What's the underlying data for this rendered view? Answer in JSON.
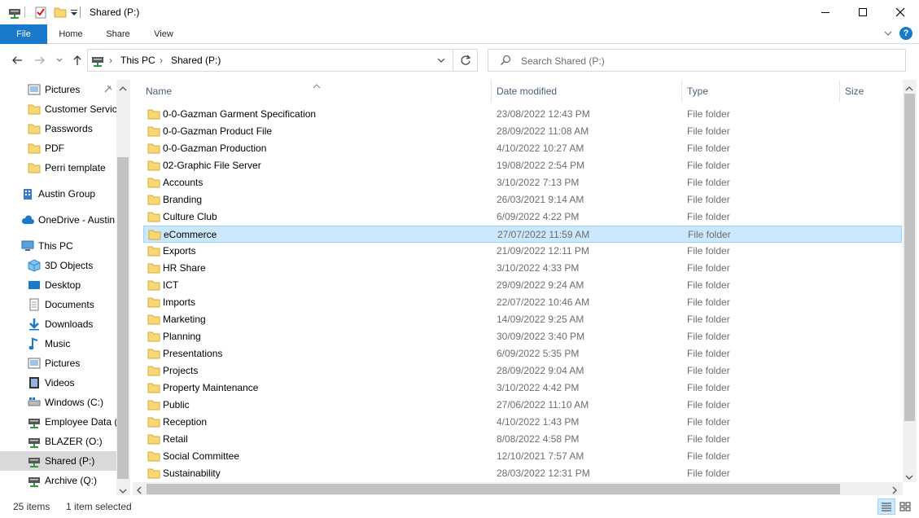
{
  "window": {
    "title": "Shared (P:)",
    "minimize_glyph": "—",
    "maximize_glyph": "☐",
    "close_glyph": "✕"
  },
  "ribbon": {
    "tabs": [
      "File",
      "Home",
      "Share",
      "View"
    ],
    "help_glyph": "?"
  },
  "address": {
    "crumbs": [
      "This PC",
      "Shared (P:)"
    ],
    "search_placeholder": "Search Shared (P:)"
  },
  "sidebar": {
    "items": [
      {
        "label": "Pictures",
        "icon": "pictures-icon",
        "pinned": true
      },
      {
        "label": "Customer Servic",
        "icon": "folder-icon"
      },
      {
        "label": "Passwords",
        "icon": "folder-icon"
      },
      {
        "label": "PDF",
        "icon": "folder-icon"
      },
      {
        "label": "Perri template",
        "icon": "folder-icon"
      },
      {
        "label": "Austin Group",
        "icon": "building-icon"
      },
      {
        "label": "OneDrive - Austin",
        "icon": "cloud-icon"
      },
      {
        "label": "This PC",
        "icon": "pc-icon"
      },
      {
        "label": "3D Objects",
        "icon": "cube-icon"
      },
      {
        "label": "Desktop",
        "icon": "desktop-icon"
      },
      {
        "label": "Documents",
        "icon": "documents-icon"
      },
      {
        "label": "Downloads",
        "icon": "download-icon"
      },
      {
        "label": "Music",
        "icon": "music-icon"
      },
      {
        "label": "Pictures",
        "icon": "pictures-icon"
      },
      {
        "label": "Videos",
        "icon": "videos-icon"
      },
      {
        "label": "Windows (C:)",
        "icon": "windows-drive-icon"
      },
      {
        "label": "Employee Data (",
        "icon": "network-drive-icon"
      },
      {
        "label": "BLAZER (O:)",
        "icon": "network-drive-icon"
      },
      {
        "label": "Shared (P:)",
        "icon": "network-drive-icon",
        "selected": true
      },
      {
        "label": "Archive (Q:)",
        "icon": "network-drive-icon"
      }
    ]
  },
  "columns": [
    "Name",
    "Date modified",
    "Type",
    "Size"
  ],
  "files": [
    {
      "name": "0-0-Gazman Garment Specification",
      "date": "23/08/2022 12:43 PM",
      "type": "File folder"
    },
    {
      "name": "0-0-Gazman Product File",
      "date": "28/09/2022 11:08 AM",
      "type": "File folder"
    },
    {
      "name": "0-0-Gazman Production",
      "date": "4/10/2022 10:27 AM",
      "type": "File folder"
    },
    {
      "name": "02-Graphic File Server",
      "date": "19/08/2022 2:54 PM",
      "type": "File folder"
    },
    {
      "name": "Accounts",
      "date": "3/10/2022 7:13 PM",
      "type": "File folder"
    },
    {
      "name": "Branding",
      "date": "26/03/2021 9:14 AM",
      "type": "File folder"
    },
    {
      "name": "Culture Club",
      "date": "6/09/2022 4:22 PM",
      "type": "File folder"
    },
    {
      "name": "eCommerce",
      "date": "27/07/2022 11:59 AM",
      "type": "File folder",
      "selected": true
    },
    {
      "name": "Exports",
      "date": "21/09/2022 12:11 PM",
      "type": "File folder"
    },
    {
      "name": "HR Share",
      "date": "3/10/2022 4:33 PM",
      "type": "File folder"
    },
    {
      "name": "ICT",
      "date": "29/09/2022 9:24 AM",
      "type": "File folder"
    },
    {
      "name": "Imports",
      "date": "22/07/2022 10:46 AM",
      "type": "File folder"
    },
    {
      "name": "Marketing",
      "date": "14/09/2022 9:25 AM",
      "type": "File folder"
    },
    {
      "name": "Planning",
      "date": "30/09/2022 3:40 PM",
      "type": "File folder"
    },
    {
      "name": "Presentations",
      "date": "6/09/2022 5:35 PM",
      "type": "File folder"
    },
    {
      "name": "Projects",
      "date": "28/09/2022 9:04 AM",
      "type": "File folder"
    },
    {
      "name": "Property Maintenance",
      "date": "3/10/2022 4:42 PM",
      "type": "File folder"
    },
    {
      "name": "Public",
      "date": "27/06/2022 11:10 AM",
      "type": "File folder"
    },
    {
      "name": "Reception",
      "date": "4/10/2022 1:43 PM",
      "type": "File folder"
    },
    {
      "name": "Retail",
      "date": "8/08/2022 4:58 PM",
      "type": "File folder"
    },
    {
      "name": "Social Committee",
      "date": "12/10/2021 7:57 AM",
      "type": "File folder"
    },
    {
      "name": "Sustainability",
      "date": "28/03/2022 12:31 PM",
      "type": "File folder"
    }
  ],
  "status": {
    "item_count": "25 items",
    "selection": "1 item selected"
  },
  "colors": {
    "accent": "#1979ca",
    "selection": "#cce8ff",
    "folder": "#f8d775"
  }
}
